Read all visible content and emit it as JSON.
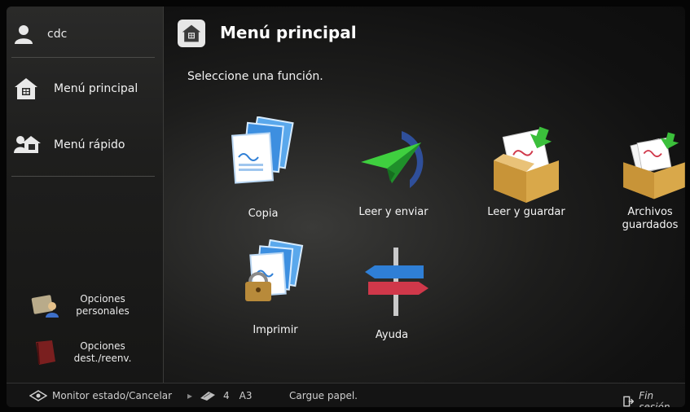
{
  "user": {
    "name": "cdc",
    "icon": "user-icon"
  },
  "sidebar": {
    "items": [
      {
        "label": "Menú principal",
        "icon": "home-icon"
      },
      {
        "label": "Menú rápido",
        "icon": "quick-menu-icon"
      }
    ],
    "bottom": [
      {
        "label": "Opciones personales",
        "icon": "personal-settings-icon"
      },
      {
        "label": "Opciones dest./reenv.",
        "icon": "address-book-icon"
      }
    ]
  },
  "header": {
    "title": "Menú principal",
    "icon": "home-icon"
  },
  "main": {
    "instruction": "Seleccione una función.",
    "functions": [
      {
        "label": "Copia",
        "icon": "copy-icon"
      },
      {
        "label": "Leer y enviar",
        "icon": "paper-plane-icon"
      },
      {
        "label": "Leer y guardar",
        "icon": "scan-store-box-icon"
      },
      {
        "label": "Archivos guardados",
        "icon": "stored-files-box-icon"
      },
      {
        "label": "Imprimir",
        "icon": "print-lock-icon"
      },
      {
        "label": "Ayuda",
        "icon": "signpost-icon"
      }
    ]
  },
  "statusbar": {
    "monitor_label": "Monitor estado/Cancelar",
    "paper_count": "4",
    "paper_size": "A3",
    "message": "Cargue papel.",
    "logout_label": "Fin sesión"
  },
  "colors": {
    "accent_green": "#3bbf3b",
    "accent_blue": "#2f7fd6",
    "box_tan": "#d9a84a",
    "sign_red": "#d0384a"
  }
}
